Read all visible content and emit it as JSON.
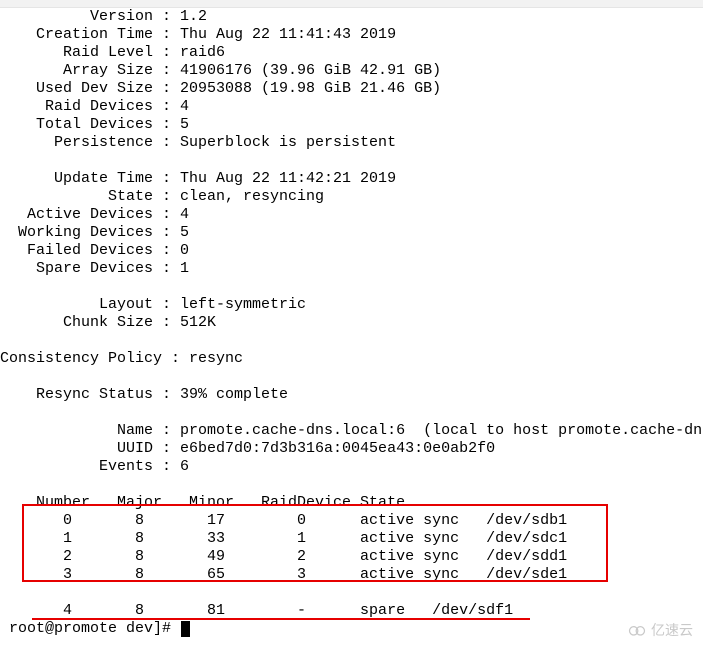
{
  "details": {
    "Version": "          Version : 1.2",
    "Creation_Time": "    Creation Time : Thu Aug 22 11:41:43 2019",
    "Raid_Level": "       Raid Level : raid6",
    "Array_Size": "       Array Size : 41906176 (39.96 GiB 42.91 GB)",
    "Used_Dev_Size": "    Used Dev Size : 20953088 (19.98 GiB 21.46 GB)",
    "Raid_Devices": "     Raid Devices : 4",
    "Total_Devices": "    Total Devices : 5",
    "Persistence": "      Persistence : Superblock is persistent",
    "Update_Time": "      Update Time : Thu Aug 22 11:42:21 2019",
    "State": "            State : clean, resyncing",
    "Active_Devices": "   Active Devices : 4",
    "Working_Devices": "  Working Devices : 5",
    "Failed_Devices": "   Failed Devices : 0",
    "Spare_Devices": "    Spare Devices : 1",
    "Layout": "           Layout : left-symmetric",
    "Chunk_Size": "       Chunk Size : 512K",
    "Consistency_Policy": "Consistency Policy : resync",
    "Resync_Status": "    Resync Status : 39% complete",
    "Name": "             Name : promote.cache-dns.local:6  (local to host promote.cache-dn",
    "UUID": "             UUID : e6bed7d0:7d3b316a:0045ea43:0e0ab2f0",
    "Events": "           Events : 6"
  },
  "device_table": {
    "header": "    Number   Major   Minor   RaidDevice State",
    "row0": "       0       8       17        0      active sync   /dev/sdb1",
    "row1": "       1       8       33        1      active sync   /dev/sdc1",
    "row2": "       2       8       49        2      active sync   /dev/sdd1",
    "row3": "       3       8       65        3      active sync   /dev/sde1",
    "spare": "       4       8       81        -      spare   /dev/sdf1"
  },
  "prompt": {
    "text": " root@promote dev]# "
  },
  "watermark": {
    "text": "亿速云"
  }
}
